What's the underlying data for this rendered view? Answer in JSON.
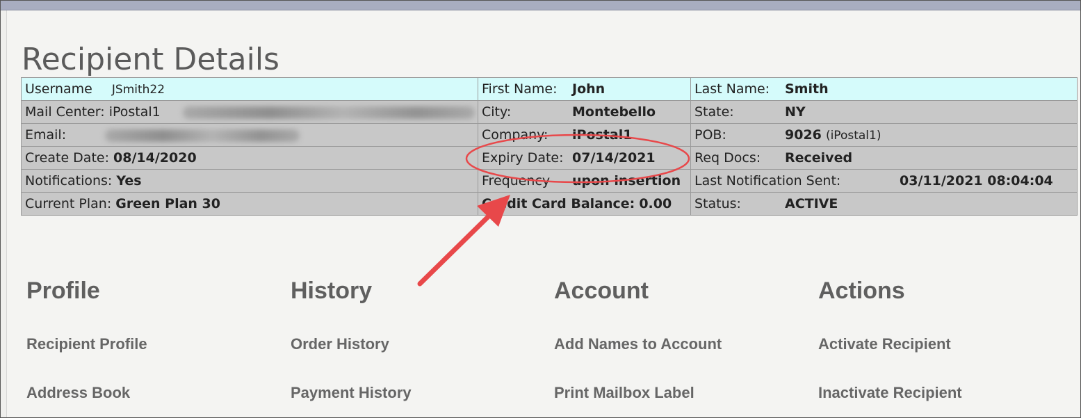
{
  "page": {
    "title": "Recipient Details"
  },
  "details": {
    "username_label": "Username",
    "username": "JSmith22",
    "first_name_label": "First Name:",
    "first_name": "John",
    "last_name_label": "Last Name:",
    "last_name": "Smith",
    "mail_center_label": "Mail Center:",
    "mail_center": "iPostal1",
    "city_label": "City:",
    "city": "Montebello",
    "state_label": "State:",
    "state": "NY",
    "email_label": "Email:",
    "company_label": "Company:",
    "company": "iPostal1",
    "pob_label": "POB:",
    "pob": "9026",
    "pob_suffix": "(iPostal1)",
    "create_date_label": "Create Date:",
    "create_date": "08/14/2020",
    "expiry_date_label": "Expiry Date:",
    "expiry_date": "07/14/2021",
    "req_docs_label": "Req Docs:",
    "req_docs": "Received",
    "notifications_label": "Notifications:",
    "notifications": "Yes",
    "frequency_label": "Frequency",
    "frequency": "upon insertion",
    "last_notification_label": "Last Notification Sent:",
    "last_notification": "03/11/2021 08:04:04",
    "current_plan_label": "Current Plan:",
    "current_plan": "Green Plan 30",
    "cc_balance_label": "Credit Card Balance:",
    "cc_balance": "0.00",
    "status_label": "Status:",
    "status": "ACTIVE"
  },
  "sections": {
    "profile": {
      "heading": "Profile",
      "link1": "Recipient Profile",
      "link2": "Address Book"
    },
    "history": {
      "heading": "History",
      "link1": "Order History",
      "link2": "Payment History"
    },
    "account": {
      "heading": "Account",
      "link1": "Add Names to Account",
      "link2": "Print Mailbox Label"
    },
    "actions": {
      "heading": "Actions",
      "link1": "Activate Recipient",
      "link2": "Inactivate Recipient"
    }
  },
  "annotation": {
    "color": "#e8484a"
  }
}
